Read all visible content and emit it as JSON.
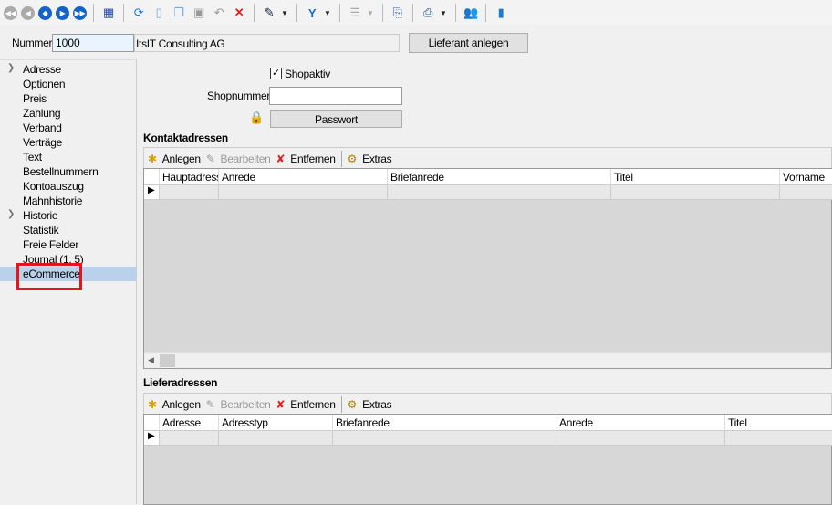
{
  "toolbar": {
    "icons": [
      "first-icon",
      "previous-icon",
      "jump-icon",
      "next-icon",
      "last-icon",
      "table-icon",
      "refresh-icon",
      "new-icon",
      "copy-icon",
      "save-icon",
      "undo-icon",
      "delete-icon",
      "pin-icon",
      "filter-icon",
      "tree-icon",
      "document-pointer-icon",
      "print-icon",
      "users-icon",
      "exit-door-icon"
    ]
  },
  "header": {
    "nummer_label": "Nummer",
    "nummer_value": "1000",
    "name_value": "ItsIT Consulting AG",
    "create_button": "Lieferant anlegen"
  },
  "sidebar": {
    "items": [
      {
        "label": "Adresse",
        "expandable": true
      },
      {
        "label": "Optionen"
      },
      {
        "label": "Preis"
      },
      {
        "label": "Zahlung"
      },
      {
        "label": "Verband"
      },
      {
        "label": "Verträge"
      },
      {
        "label": "Text"
      },
      {
        "label": "Bestellnummern"
      },
      {
        "label": "Kontoauszug"
      },
      {
        "label": "Mahnhistorie"
      },
      {
        "label": "Historie",
        "expandable": true
      },
      {
        "label": "Statistik"
      },
      {
        "label": "Freie Felder"
      },
      {
        "label": "Journal (1, 5)"
      },
      {
        "label": "eCommerce",
        "selected": true
      }
    ]
  },
  "shop": {
    "shopaktiv_label": "Shopaktiv",
    "shopaktiv_checked": true,
    "shopnummer_label": "Shopnummer",
    "shopnummer_value": "",
    "password_button": "Passwort"
  },
  "kontakt": {
    "title": "Kontaktadressen",
    "actions": {
      "add": "Anlegen",
      "edit": "Bearbeiten",
      "remove": "Entfernen",
      "extras": "Extras"
    },
    "columns": [
      "Hauptadresse",
      "Anrede",
      "Briefanrede",
      "Titel",
      "Vorname"
    ]
  },
  "liefer": {
    "title": "Lieferadressen",
    "actions": {
      "add": "Anlegen",
      "edit": "Bearbeiten",
      "remove": "Entfernen",
      "extras": "Extras"
    },
    "columns": [
      "Adresse",
      "Adresstyp",
      "Briefanrede",
      "Anrede",
      "Titel"
    ]
  },
  "colors": {
    "selection": "#b9d1ea",
    "highlight_box": "#e8141c"
  }
}
